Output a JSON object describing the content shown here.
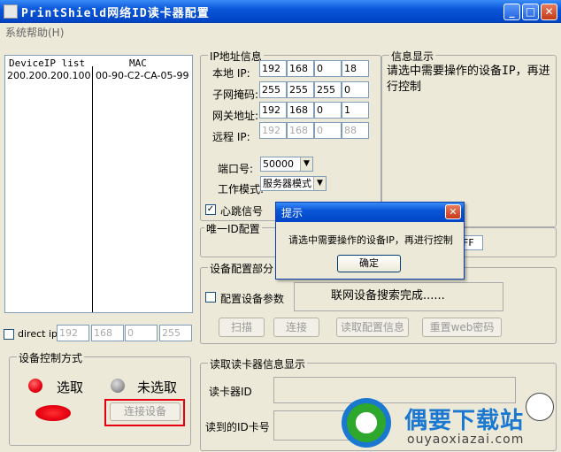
{
  "window": {
    "title": "PrintShield网络ID读卡器配置"
  },
  "menu": {
    "help": "系统帮助(H)"
  },
  "device_list": {
    "col1": "DeviceIP list",
    "col2": "MAC",
    "rows": [
      {
        "ip": "200.200.200.100",
        "mac": "00-90-C2-CA-05-99"
      }
    ]
  },
  "ip_info": {
    "legend": "IP地址信息",
    "local_ip_label": "本地 IP:",
    "local_ip": [
      "192",
      "168",
      "0",
      "18"
    ],
    "subnet_label": "子网掩码:",
    "subnet": [
      "255",
      "255",
      "255",
      "0"
    ],
    "gateway_label": "网关地址:",
    "gateway": [
      "192",
      "168",
      "0",
      "1"
    ],
    "remote_ip_label": "远程 IP:",
    "remote_ip": [
      "192",
      "168",
      "0",
      "88"
    ],
    "port_label": "端口号:",
    "port_value": "50000",
    "mode_label": "工作模式:",
    "mode_value": "服务器模式",
    "heartbeat_label": "心跳信号"
  },
  "info_display": {
    "legend": "信息显示",
    "text": "请选中需要操作的设备IP，再进行控制"
  },
  "unique_id": {
    "legend": "唯一ID配置",
    "value_tail": "FF"
  },
  "device_config": {
    "legend": "设备配置部分",
    "config_params": "配置设备参数",
    "status": "联网设备搜索完成......",
    "scan": "扫描",
    "connect": "连接",
    "read_config": "读取配置信息",
    "reset_web_pwd": "重置web密码"
  },
  "direct_ip": {
    "label": "direct ip",
    "values": [
      "192",
      "168",
      "0",
      "255"
    ]
  },
  "control": {
    "legend": "设备控制方式",
    "selected": "选取",
    "unselected": "未选取",
    "connect_device": "连接设备"
  },
  "reader_info": {
    "legend": "读取读卡器信息显示",
    "reader_id": "读卡器ID",
    "card_id": "读到的ID卡号"
  },
  "dialog": {
    "title": "提示",
    "message": "请选中需要操作的设备IP，再进行控制",
    "ok": "确定"
  },
  "watermark": {
    "brand": "偶要下载站",
    "url": "ouyaoxiazai.com"
  },
  "colors": {
    "title_blue": "#0a56d8",
    "red": "#e60012",
    "gray": "#888888",
    "highlight_box": "#e60012"
  }
}
